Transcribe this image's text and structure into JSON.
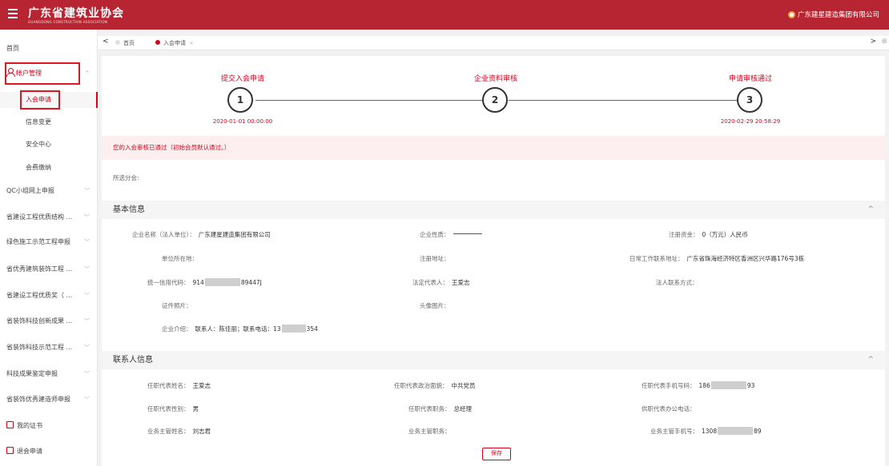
{
  "header": {
    "logo_cn": "广东省建筑业协会",
    "logo_en": "GUANGDONG CONSTRUCTION ASSOCIATION",
    "company": "广东建星建造集团有限公司",
    "bg_color": "#b82532"
  },
  "sidebar": {
    "home": "首页",
    "account": "帐户管理",
    "account_subs": [
      "入会申请",
      "信息变更",
      "安全中心",
      "会费缴纳"
    ],
    "groups": [
      "QC小组网上申报",
      "省建设工程优质结构 ...",
      "绿色施工示范工程申报",
      "省优秀建筑装饰工程 ...",
      "省建设工程优质奖（ ...",
      "省装饰科技创新成果 ...",
      "省装饰科技示范工程 ...",
      "科技成果鉴定申报",
      "省装饰优秀建造师申报"
    ],
    "certificate": "我的证书",
    "withdraw": "退会申请"
  },
  "tabs": {
    "prev": "<",
    "next": ">",
    "home": "首页",
    "current": "入会申请",
    "close": "×",
    "close_all": "⊗"
  },
  "steps": [
    {
      "title": "提交入会申请",
      "num": "1",
      "time": "2020-01-01 00:00:00"
    },
    {
      "title": "企业资料审核",
      "num": "2",
      "time": ""
    },
    {
      "title": "申请审核通过",
      "num": "3",
      "time": "2020-02-29 20:58:29"
    }
  ],
  "alert": "您的入会审核已通过（初始会员默认通过。）",
  "branch_label": "所选分会:",
  "basic": {
    "title": "基本信息",
    "caret": "^",
    "name_k": "企业名称（法人单位）：",
    "name_v": "广东建星建造集团有限公司",
    "nature_k": "企业性质：",
    "capital_k": "注册资金：",
    "capital_v": "0（万元）人民币",
    "location_k": "单位所在地：",
    "reg_addr_k": "注册地址：",
    "work_addr_k": "日常工作联系地址：",
    "work_addr_v": "广东省珠海经济特区香洲区兴华路176号3栋",
    "credit_k": "统一信用代码：",
    "credit_v1": "914",
    "credit_v2": "89447J",
    "legal_k": "法定代表人：",
    "legal_v": "王爱志",
    "legal_contact_k": "法人联系方式：",
    "cert_k": "证件照片：",
    "avatar_k": "头像图片：",
    "intro_k": "企业介绍：",
    "intro_v1": "联系人：陈佳丽；联系电话：13",
    "intro_v2": "354"
  },
  "contact": {
    "title": "联系人信息",
    "caret": "^",
    "rep_name_k": "任职代表姓名：",
    "rep_name_v": "王爱志",
    "rep_politics_k": "任职代表政治面貌：",
    "rep_politics_v": "中共党员",
    "rep_phone_k": "任职代表手机号码：",
    "rep_phone_v1": "186",
    "rep_phone_v2": "93",
    "rep_gender_k": "任职代表性别：",
    "rep_gender_v": "男",
    "rep_title_k": "任职代表职务：",
    "rep_title_v": "总经理",
    "rep_office_k": "供职代表办公电话：",
    "mgr_name_k": "业务主管姓名：",
    "mgr_name_v": "刘志君",
    "mgr_title_k": "业务主管职务：",
    "mgr_phone_k": "业务主管手机号：",
    "mgr_phone_v1": "1308",
    "mgr_phone_v2": "89"
  },
  "save_label": "保存",
  "accent_color": "#d9001b"
}
